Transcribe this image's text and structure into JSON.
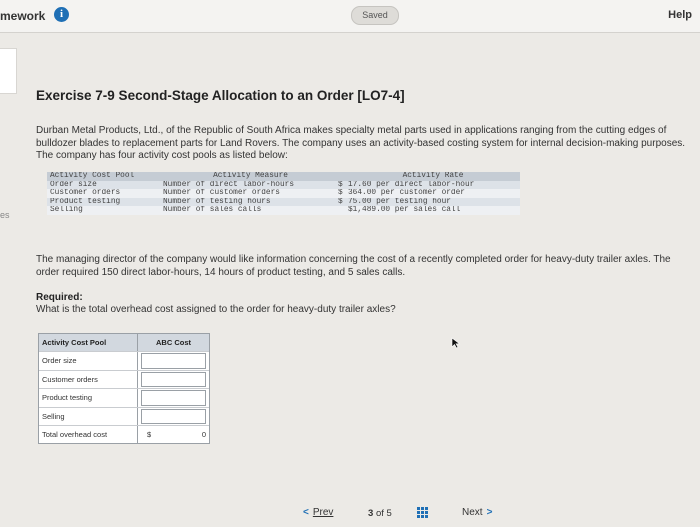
{
  "header": {
    "app_title": "mework",
    "info_icon": "i",
    "saved_label": "Saved",
    "help_label": "Help"
  },
  "side_fragment": "es",
  "exercise": {
    "title": "Exercise 7-9 Second-Stage Allocation to an Order [LO7-4]",
    "intro": "Durban Metal Products, Ltd., of the Republic of South Africa makes specialty metal parts used in applications ranging from the cutting edges of bulldozer blades to replacement parts for Land Rovers. The company uses an activity-based costing system for internal decision-making purposes. The company has four activity cost pools as listed below:",
    "cost_pool_table": {
      "headers": [
        "Activity Cost Pool",
        "Activity Measure",
        "Activity Rate"
      ],
      "rows": [
        {
          "pool": "Order size",
          "measure": "Number of direct labor-hours",
          "sym": "$",
          "rate": "17.60 per direct labor-hour"
        },
        {
          "pool": "Customer orders",
          "measure": "Number of customer orders",
          "sym": "$",
          "rate": "364.00 per customer order"
        },
        {
          "pool": "Product testing",
          "measure": "Number of testing hours",
          "sym": "$",
          "rate": "75.00 per testing hour"
        },
        {
          "pool": "Selling",
          "measure": "Number of sales calls",
          "sym": "",
          "rate": "$1,489.00 per sales call"
        }
      ]
    },
    "paragraph2": "The managing director of the company would like information concerning the cost of a recently completed order for heavy-duty trailer axles. The order required 150 direct labor-hours, 14 hours of product testing, and 5 sales calls.",
    "required_label": "Required:",
    "required_question": "What is the total overhead cost assigned to the order for heavy-duty trailer axles?"
  },
  "answer_table": {
    "headers": [
      "Activity Cost Pool",
      "ABC Cost"
    ],
    "rows": [
      {
        "label": "Order size",
        "value": ""
      },
      {
        "label": "Customer orders",
        "value": ""
      },
      {
        "label": "Product testing",
        "value": ""
      },
      {
        "label": "Selling",
        "value": ""
      }
    ],
    "total": {
      "label": "Total overhead cost",
      "currency": "$",
      "value": "0"
    }
  },
  "footer": {
    "prev_label": "Prev",
    "page_current": "3",
    "page_of": "of",
    "page_total": "5",
    "next_label": "Next"
  },
  "colors": {
    "accent": "#1f6fb5",
    "table_header": "#c5ccd4"
  },
  "icons": [
    "info-icon",
    "grid-icon",
    "chevron-left-icon",
    "chevron-right-icon",
    "cursor-icon"
  ]
}
